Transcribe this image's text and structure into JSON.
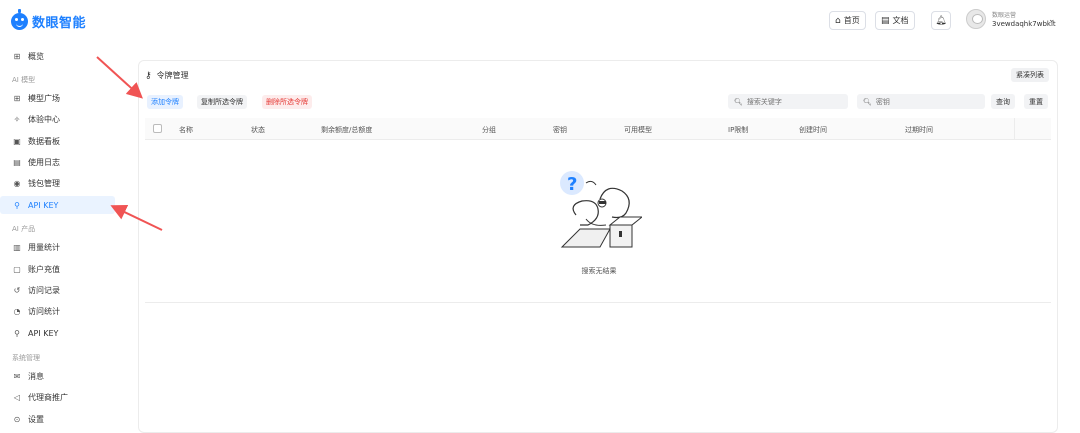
{
  "header": {
    "logo_text": "数眼智能",
    "home_label": "首页",
    "docs_label": "文档",
    "user_role": "数眼运营",
    "user_name": "3vewdaqhk7wbkit"
  },
  "sidebar": {
    "items_top": [
      {
        "label": "概览",
        "icon": "grid-icon"
      }
    ],
    "group_ai_model": "AI 模型",
    "items_ai_model": [
      {
        "label": "模型广场",
        "icon": "grid-icon"
      },
      {
        "label": "体验中心",
        "icon": "sparkle-icon"
      },
      {
        "label": "数据看板",
        "icon": "dashboard-icon"
      },
      {
        "label": "使用日志",
        "icon": "log-icon"
      },
      {
        "label": "钱包管理",
        "icon": "wallet-icon"
      },
      {
        "label": "API KEY",
        "icon": "key-icon"
      }
    ],
    "group_ai_product": "AI 产品",
    "items_ai_product": [
      {
        "label": "用量统计",
        "icon": "chart-icon"
      },
      {
        "label": "账户充值",
        "icon": "recharge-icon"
      },
      {
        "label": "访问记录",
        "icon": "history-icon"
      },
      {
        "label": "访问统计",
        "icon": "pie-icon"
      },
      {
        "label": "API KEY",
        "icon": "key-icon"
      }
    ],
    "group_system": "系统管理",
    "items_system": [
      {
        "label": "消息",
        "icon": "mail-icon"
      },
      {
        "label": "代理商推广",
        "icon": "megaphone-icon"
      },
      {
        "label": "设置",
        "icon": "settings-icon"
      }
    ]
  },
  "panel": {
    "title": "令牌管理",
    "compact_label": "紧凑列表",
    "add_label": "添加令牌",
    "copy_label": "复制所选令牌",
    "delete_label": "删除所选令牌",
    "search_keyword_placeholder": "搜索关键字",
    "search_key_placeholder": "密钥",
    "query_label": "查询",
    "reset_label": "重置",
    "columns": [
      "名称",
      "状态",
      "剩余额度/总额度",
      "分组",
      "密钥",
      "可用模型",
      "IP限制",
      "创建时间",
      "过期时间"
    ],
    "empty_text": "搜索无结果"
  },
  "colors": {
    "brand": "#1e80ff",
    "danger": "#e53935",
    "annotation_arrow": "#f05454"
  }
}
